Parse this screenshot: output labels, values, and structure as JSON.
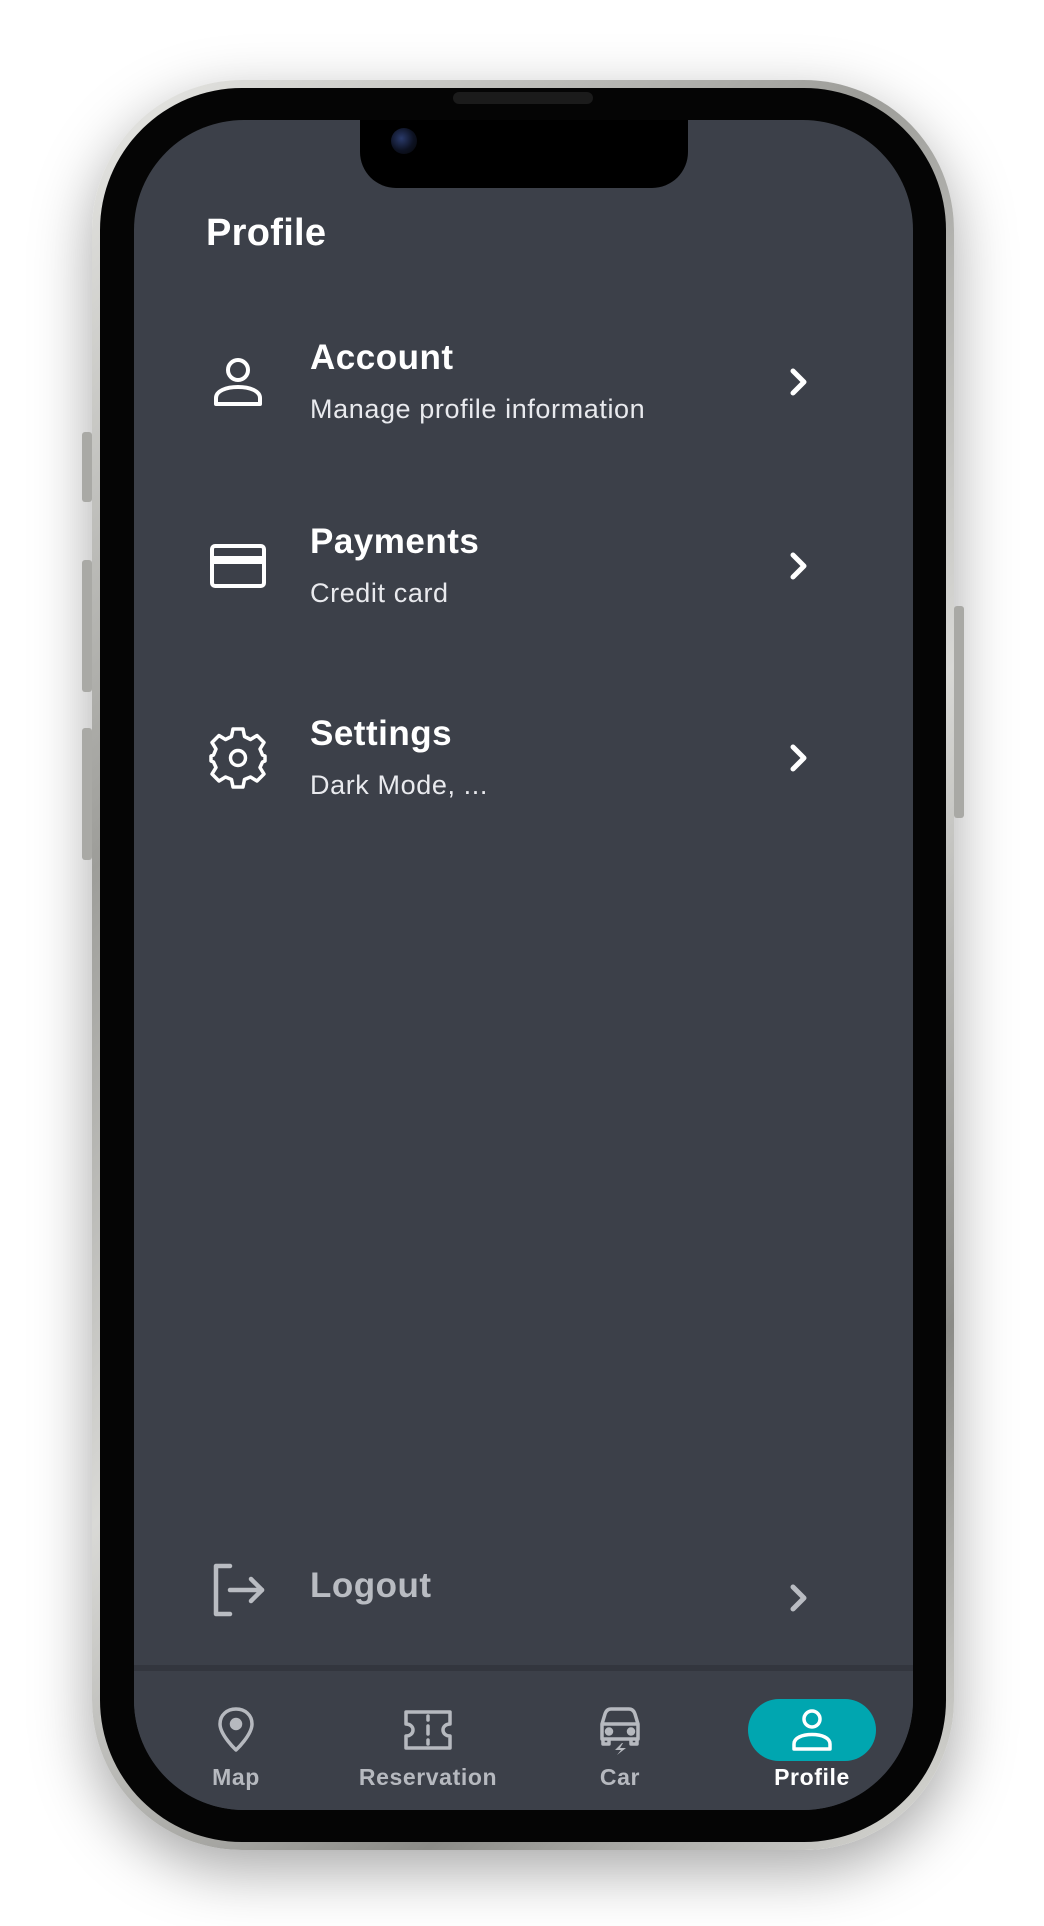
{
  "page": {
    "title": "Profile"
  },
  "menu": [
    {
      "icon": "person-icon",
      "title": "Account",
      "subtitle": "Manage profile information"
    },
    {
      "icon": "credit-card-icon",
      "title": "Payments",
      "subtitle": "Credit card"
    },
    {
      "icon": "gear-icon",
      "title": "Settings",
      "subtitle": "Dark Mode, ..."
    }
  ],
  "logout": {
    "icon": "logout-icon",
    "label": "Logout"
  },
  "nav": {
    "items": [
      {
        "icon": "map-pin-icon",
        "label": "Map",
        "active": false
      },
      {
        "icon": "ticket-icon",
        "label": "Reservation",
        "active": false
      },
      {
        "icon": "car-icon",
        "label": "Car",
        "active": false
      },
      {
        "icon": "person-icon",
        "label": "Profile",
        "active": true
      }
    ]
  },
  "colors": {
    "background": "#3c4049",
    "accent": "#00a6b0",
    "text": "#ffffff",
    "muted": "#b6b9bf"
  }
}
